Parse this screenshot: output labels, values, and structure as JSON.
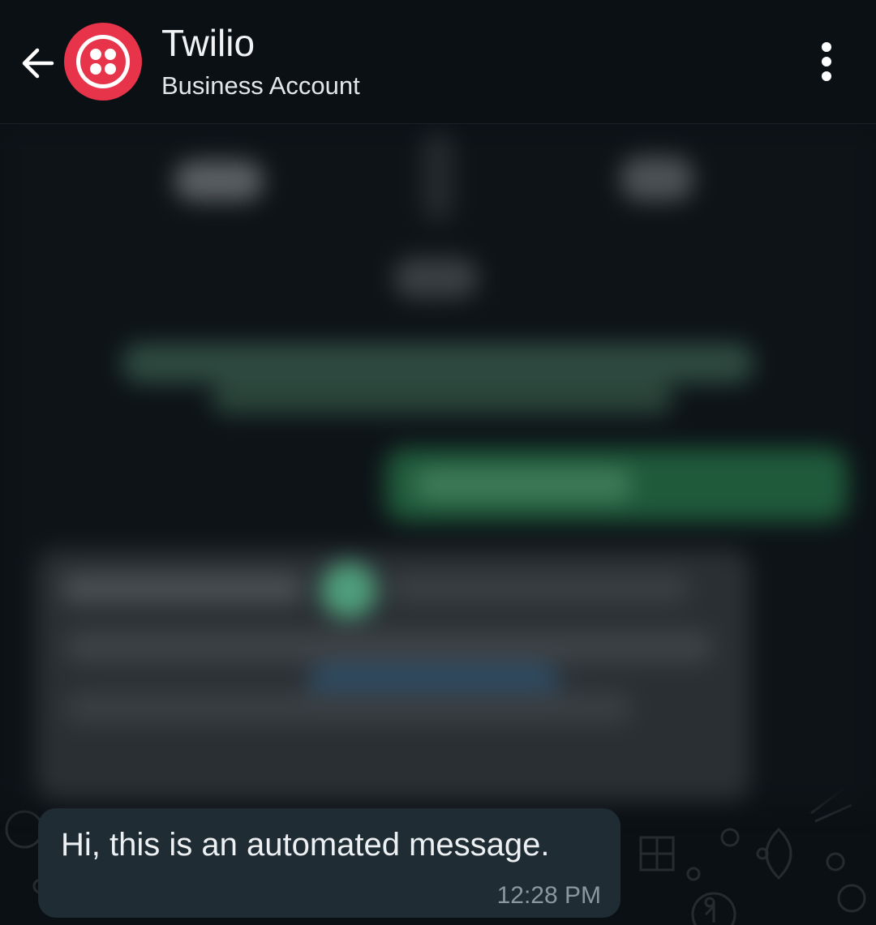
{
  "header": {
    "contact_name": "Twilio",
    "contact_subtitle": "Business Account",
    "avatar_color": "#e8344b",
    "back_icon": "arrow-left-icon",
    "menu_icon": "more-vertical-icon"
  },
  "chat": {
    "messages": [
      {
        "text": "Hi, this is an automated message.",
        "time": "12:28 PM",
        "direction": "incoming"
      }
    ]
  },
  "colors": {
    "background": "#0b1014",
    "bubble_incoming": "#1f2c33",
    "accent_green": "#25d366"
  }
}
